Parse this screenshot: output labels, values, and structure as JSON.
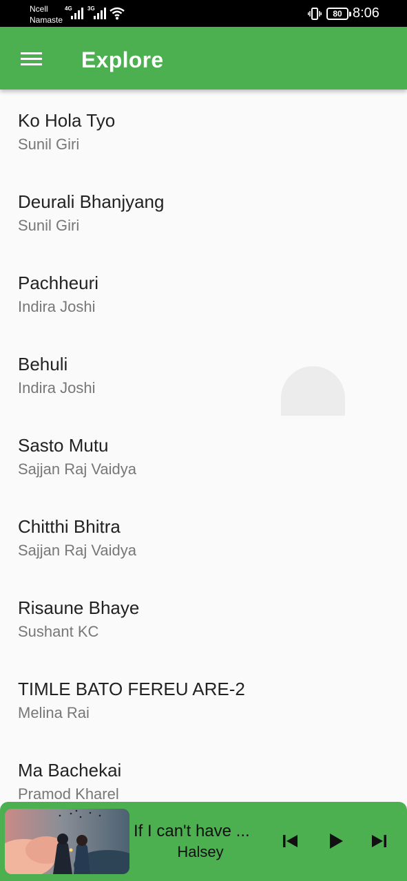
{
  "status_bar": {
    "carrier_line1": "Ncell",
    "carrier_line2": "Namaste",
    "network1": "4G",
    "network2": "3G",
    "battery": "80",
    "time": "8:06",
    "icons": [
      "signal-icon",
      "wifi-icon",
      "vibrate-icon",
      "battery-icon"
    ]
  },
  "appbar": {
    "title": "Explore",
    "menu_icon": "hamburger-menu-icon"
  },
  "songs": [
    {
      "title": "Ko Hola Tyo",
      "artist": "Sunil Giri"
    },
    {
      "title": "Deurali Bhanjyang",
      "artist": "Sunil Giri"
    },
    {
      "title": "Pachheuri",
      "artist": "Indira Joshi"
    },
    {
      "title": "Behuli",
      "artist": "Indira Joshi"
    },
    {
      "title": "Sasto Mutu",
      "artist": "Sajjan Raj Vaidya"
    },
    {
      "title": "Chitthi Bhitra",
      "artist": "Sajjan Raj Vaidya"
    },
    {
      "title": "Risaune Bhaye",
      "artist": "Sushant KC"
    },
    {
      "title": "TIMLE BATO FEREU ARE-2",
      "artist": "Melina Rai"
    },
    {
      "title": "Ma Bachekai",
      "artist": "Pramod Kharel"
    }
  ],
  "player": {
    "title": "If I can't have ...",
    "artist": "Halsey",
    "controls": [
      "skip-previous-icon",
      "play-icon",
      "skip-next-icon"
    ]
  },
  "colors": {
    "primary": "#4caf50",
    "background": "#fafafa",
    "status_bar": "#000000"
  }
}
